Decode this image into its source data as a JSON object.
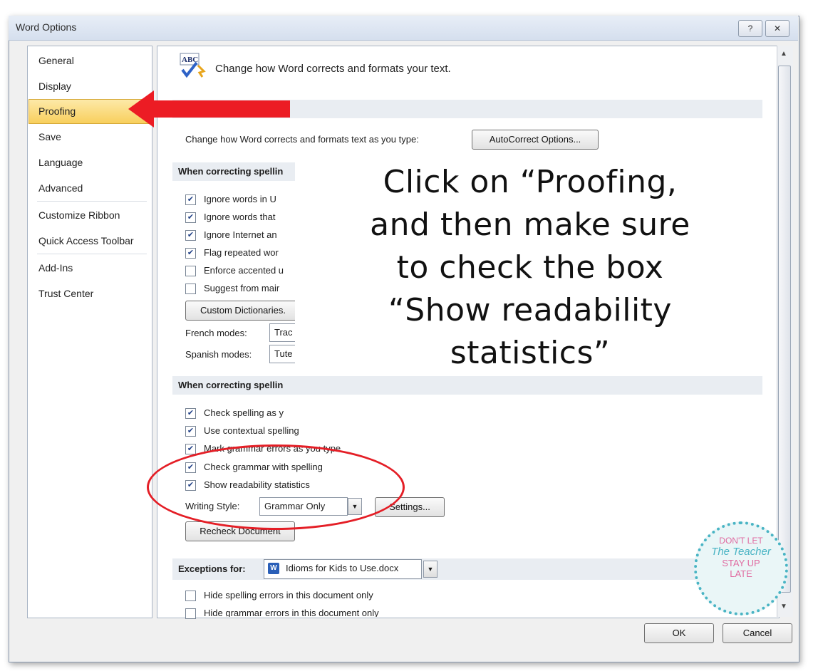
{
  "window": {
    "title": "Word Options",
    "help_label": "?",
    "close_label": "✕"
  },
  "sidebar": {
    "items": [
      {
        "label": "General"
      },
      {
        "label": "Display"
      },
      {
        "label": "Proofing"
      },
      {
        "label": "Save"
      },
      {
        "label": "Language"
      },
      {
        "label": "Advanced"
      },
      {
        "label": "Customize Ribbon"
      },
      {
        "label": "Quick Access Toolbar"
      },
      {
        "label": "Add-Ins"
      },
      {
        "label": "Trust Center"
      }
    ],
    "selected": "Proofing"
  },
  "header": {
    "icon_text": "ABC",
    "text": "Change how Word corrects and formats your text."
  },
  "autocorrect": {
    "text": "Change how Word corrects and formats text as you type:",
    "button_label": "AutoCorrect Options..."
  },
  "section_spelling": {
    "title": "When correcting spellin",
    "options": [
      {
        "label": "Ignore words in U",
        "checked": true
      },
      {
        "label": "Ignore words that",
        "checked": true
      },
      {
        "label": "Ignore Internet an",
        "checked": true
      },
      {
        "label": "Flag repeated wor",
        "checked": true
      },
      {
        "label": "Enforce accented u",
        "checked": false
      },
      {
        "label": "Suggest from mair",
        "checked": false
      }
    ],
    "custom_dict_label": "Custom Dictionaries.",
    "french_label": "French modes:",
    "french_value": "Trac",
    "spanish_label": "Spanish modes:",
    "spanish_value": "Tute"
  },
  "section_grammar": {
    "title": "When correcting spellin",
    "options": [
      {
        "label": "Check spelling as y",
        "checked": true
      },
      {
        "label": "Use contextual spelling",
        "checked": true
      },
      {
        "label": "Mark grammar errors as you type",
        "checked": true
      },
      {
        "label": "Check grammar with spelling",
        "checked": true
      },
      {
        "label": "Show readability statistics",
        "checked": true
      }
    ],
    "writing_style_label": "Writing Style:",
    "writing_style_value": "Grammar Only",
    "settings_label": "Settings...",
    "recheck_label": "Recheck Document"
  },
  "exceptions": {
    "label": "Exceptions for:",
    "doc_value": "Idioms for Kids to Use.docx",
    "options": [
      {
        "label": "Hide spelling errors in this document only",
        "checked": false
      },
      {
        "label": "Hide grammar errors in this document only",
        "checked": false
      }
    ]
  },
  "footer": {
    "ok_label": "OK",
    "cancel_label": "Cancel"
  },
  "annotation": {
    "lines": [
      "Click on “Proofing,",
      "and then make sure",
      "to check the box",
      "“Show readability",
      "statistics”"
    ]
  },
  "badge": {
    "lines": [
      "DON'T LET",
      "The Teacher",
      "STAY UP",
      "LATE"
    ]
  },
  "colors": {
    "accent_red": "#ec1c24",
    "selection": "#f8cf5d",
    "badge_teal": "#49b4c4"
  }
}
